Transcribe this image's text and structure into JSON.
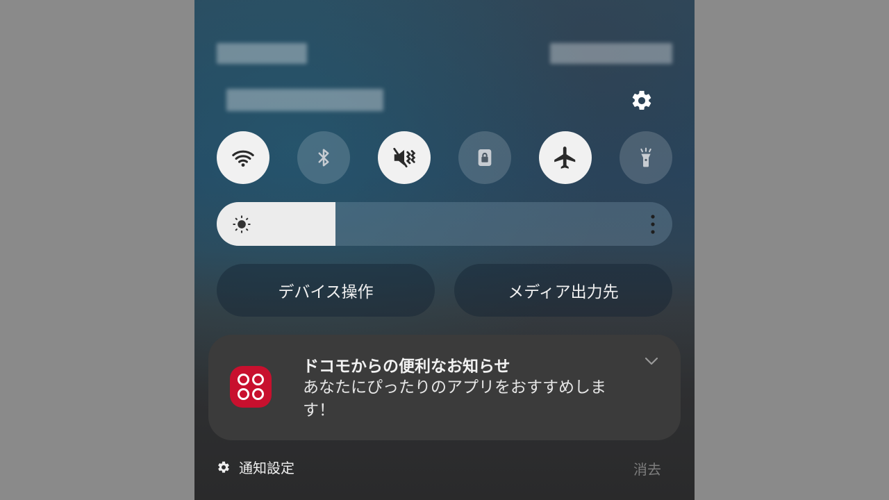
{
  "quick_panel": {
    "tiles": [
      {
        "name": "wifi",
        "icon": "wifi-icon",
        "state": "on"
      },
      {
        "name": "bluetooth",
        "icon": "bluetooth-icon",
        "state": "off"
      },
      {
        "name": "sound",
        "icon": "vibrate-mute-icon",
        "state": "on"
      },
      {
        "name": "rotation-lock",
        "icon": "lock-icon",
        "state": "off"
      },
      {
        "name": "airplane-mode",
        "icon": "airplane-icon",
        "state": "on"
      },
      {
        "name": "flashlight",
        "icon": "flashlight-icon",
        "state": "off"
      }
    ],
    "brightness_level": 0.26,
    "device_control_label": "デバイス操作",
    "media_output_label": "メディア出力先"
  },
  "notification": {
    "app_icon": "docomo-app-icon",
    "title": "ドコモからの便利なお知らせ",
    "body": "あなたにぴったりのアプリをおすすめします！"
  },
  "footer": {
    "settings_label": "通知設定",
    "clear_label": "消去"
  },
  "colors": {
    "tile_on": "#f1f1f1",
    "app_icon_bg": "#c8102e",
    "notification_bg": "#3b3b3b"
  }
}
